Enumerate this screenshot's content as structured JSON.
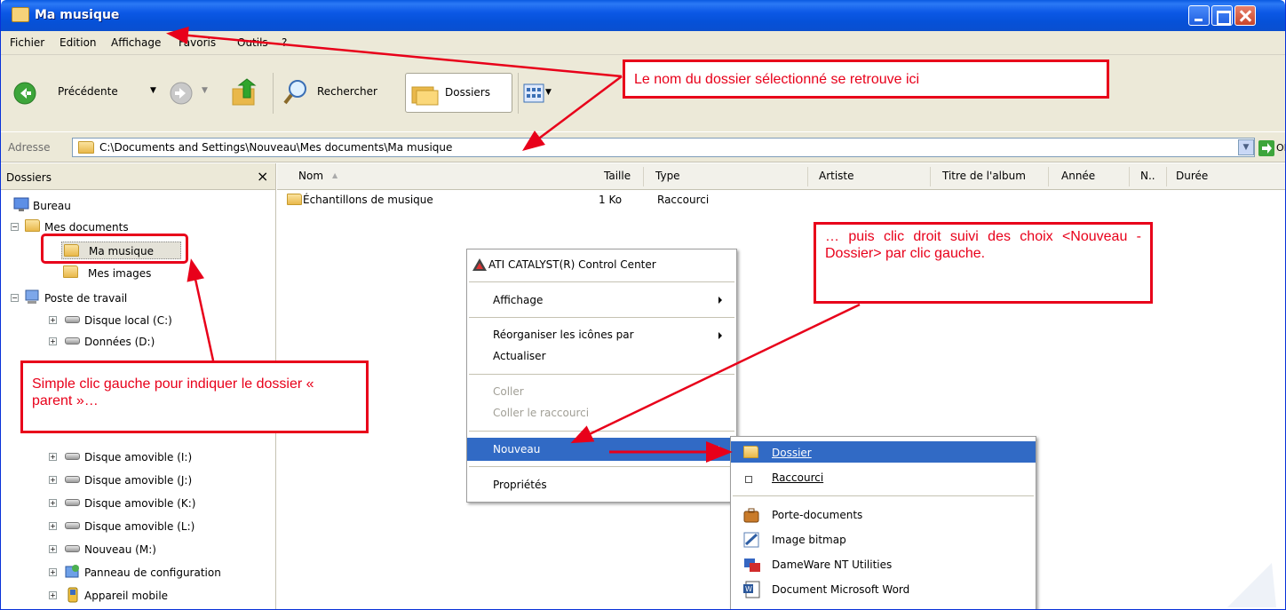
{
  "window": {
    "title": "Ma musique"
  },
  "menubar": {
    "items": [
      "Fichier",
      "Edition",
      "Affichage",
      "Favoris",
      "Outils",
      "?"
    ]
  },
  "toolbar": {
    "back_label": "Précédente",
    "search_label": "Rechercher",
    "folders_label": "Dossiers"
  },
  "address": {
    "label": "Adresse",
    "value": "C:\\Documents and Settings\\Nouveau\\Mes documents\\Ma musique",
    "go_label": "OK"
  },
  "folders_pane": {
    "title": "Dossiers",
    "close": "×",
    "tree": [
      {
        "label": "Bureau"
      },
      {
        "label": "Mes documents"
      },
      {
        "label": "Ma musique"
      },
      {
        "label": "Mes images"
      },
      {
        "label": "Poste de travail"
      },
      {
        "label": "Disque local (C:)"
      },
      {
        "label": "Données (D:)"
      },
      {
        "label": "Disque amovible (I:)"
      },
      {
        "label": "Disque amovible (J:)"
      },
      {
        "label": "Disque amovible (K:)"
      },
      {
        "label": "Disque amovible (L:)"
      },
      {
        "label": "Nouveau (M:)"
      },
      {
        "label": "Panneau de configuration"
      },
      {
        "label": "Appareil mobile"
      }
    ]
  },
  "list": {
    "columns": [
      "Nom",
      "Taille",
      "Type",
      "Artiste",
      "Titre de l'album",
      "Année",
      "N..",
      "Durée"
    ],
    "rows": [
      {
        "name": "Échantillons de musique",
        "size": "1 Ko",
        "type": "Raccourci"
      }
    ]
  },
  "context_menu": {
    "items": [
      {
        "label": "ATI CATALYST(R) Control Center"
      },
      {
        "label": "Affichage"
      },
      {
        "label": "Réorganiser les icônes par"
      },
      {
        "label": "Actualiser"
      },
      {
        "label": "Coller"
      },
      {
        "label": "Coller le raccourci"
      },
      {
        "label": "Nouveau"
      },
      {
        "label": "Propriétés"
      }
    ]
  },
  "submenu": {
    "items": [
      {
        "label": "Dossier"
      },
      {
        "label": "Raccourci"
      },
      {
        "label": "Porte-documents"
      },
      {
        "label": "Image bitmap"
      },
      {
        "label": "DameWare NT Utilities"
      },
      {
        "label": "Document Microsoft Word"
      }
    ]
  },
  "callouts": {
    "title_note": "Le nom du dossier sélectionné se retrouve ici",
    "new_folder_note": "… puis clic droit suivi des choix <Nouveau - Dossier> par clic gauche.",
    "parent_note": "Simple clic gauche pour indiquer le dossier « parent »…"
  },
  "colors": {
    "annotation_red": "#e8001a",
    "selection_blue": "#316ac5",
    "titlebar_blue": "#0a5ae0"
  }
}
